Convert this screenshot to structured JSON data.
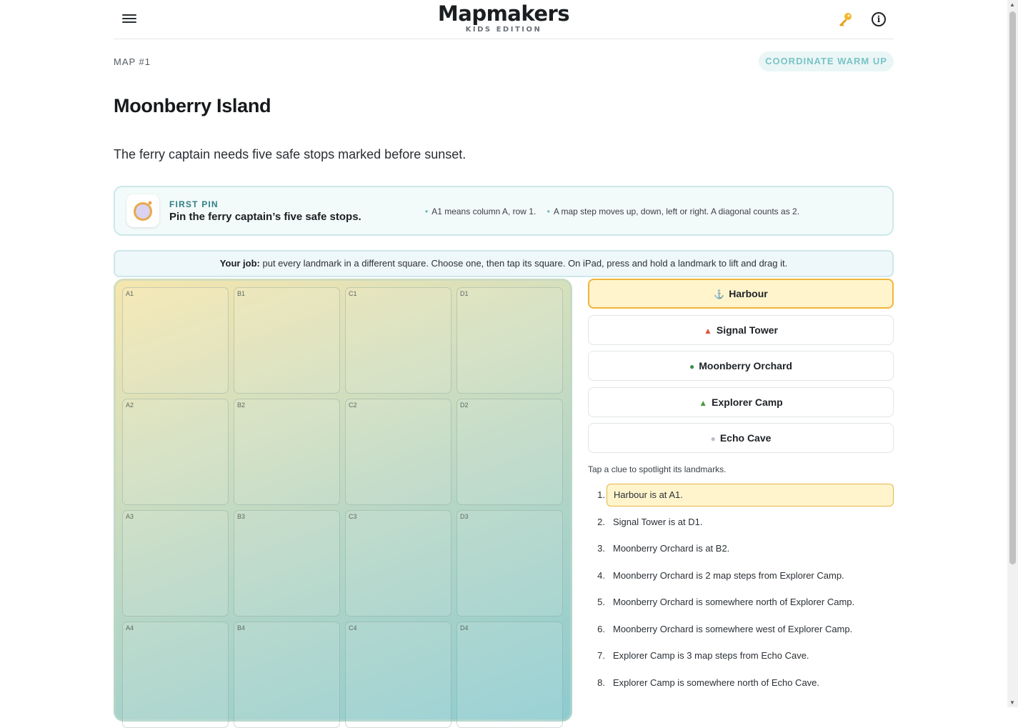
{
  "header": {
    "menu_icon": "hamburger-menu-icon",
    "brand_title": "Mapmakers",
    "brand_subtitle": "KIDS EDITION",
    "key_icon": "key-icon",
    "info_icon": "info-icon",
    "info_glyph": "i"
  },
  "map": {
    "label": "MAP #1",
    "warmup_label": "COORDINATE WARM UP",
    "title": "Moonberry Island",
    "intro": "The ferry captain needs five safe stops marked before sunset."
  },
  "first_pin": {
    "icon": "compass-icon",
    "eyebrow": "FIRST PIN",
    "headline": "Pin the ferry captain’s five safe stops.",
    "tips": [
      "A1 means column A, row 1.",
      "A map step moves up, down, left or right. A diagonal counts as 2."
    ]
  },
  "job": {
    "label": "Your job:",
    "text": " put every landmark in a different square. Choose one, then tap its square. On iPad, press and hold a landmark to lift and drag it."
  },
  "grid": {
    "cells": [
      "A1",
      "B1",
      "C1",
      "D1",
      "A2",
      "B2",
      "C2",
      "D2",
      "A3",
      "B3",
      "C3",
      "D3",
      "A4",
      "B4",
      "C4",
      "D4"
    ]
  },
  "landmarks": [
    {
      "name": "Harbour",
      "icon": "anchor-icon",
      "glyph": "⚓",
      "color": "#3a7bd5",
      "selected": true
    },
    {
      "name": "Signal Tower",
      "icon": "tower-icon",
      "glyph": "▲",
      "color": "#e0533a",
      "selected": false
    },
    {
      "name": "Moonberry Orchard",
      "icon": "tree-icon",
      "glyph": "●",
      "color": "#3f8f4a",
      "selected": false
    },
    {
      "name": "Explorer Camp",
      "icon": "tent-icon",
      "glyph": "▲",
      "color": "#4c9a3d",
      "selected": false
    },
    {
      "name": "Echo Cave",
      "icon": "cave-icon",
      "glyph": "●",
      "color": "#b9bec8",
      "selected": false
    }
  ],
  "clues": {
    "hint": "Tap a clue to spotlight its landmarks.",
    "items": [
      {
        "num": "1.",
        "text": "Harbour is at A1.",
        "active": true
      },
      {
        "num": "2.",
        "text": "Signal Tower is at D1.",
        "active": false
      },
      {
        "num": "3.",
        "text": "Moonberry Orchard is at B2.",
        "active": false
      },
      {
        "num": "4.",
        "text": "Moonberry Orchard is 2 map steps from Explorer Camp.",
        "active": false
      },
      {
        "num": "5.",
        "text": "Moonberry Orchard is somewhere north of Explorer Camp.",
        "active": false
      },
      {
        "num": "6.",
        "text": "Moonberry Orchard is somewhere west of Explorer Camp.",
        "active": false
      },
      {
        "num": "7.",
        "text": "Explorer Camp is 3 map steps from Echo Cave.",
        "active": false
      },
      {
        "num": "8.",
        "text": "Explorer Camp is somewhere north of Echo Cave.",
        "active": false
      }
    ]
  },
  "colors": {
    "accent_teal": "#2f7f86",
    "highlight_yellow": "#fff4cc",
    "highlight_border": "#f1b53a"
  }
}
